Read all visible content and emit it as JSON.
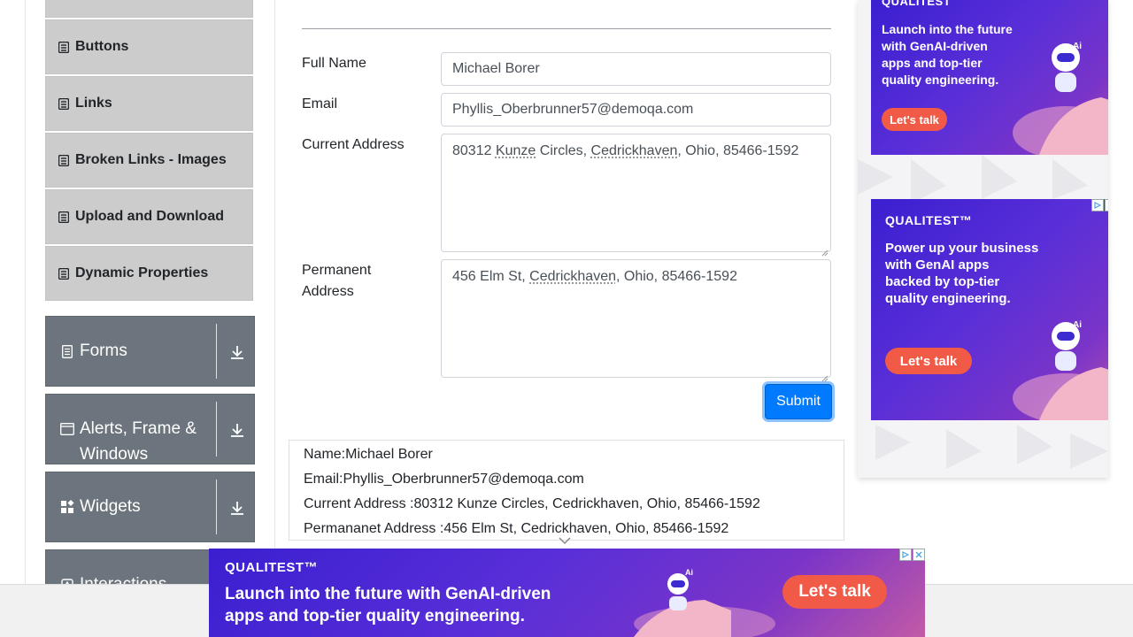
{
  "sidebar": {
    "elements_items": [
      {
        "label": "Buttons",
        "icon": "list-icon"
      },
      {
        "label": "Links",
        "icon": "list-icon"
      },
      {
        "label": "Broken Links - Images",
        "icon": "list-icon"
      },
      {
        "label": "Upload and Download",
        "icon": "list-icon"
      },
      {
        "label": "Dynamic Properties",
        "icon": "list-icon"
      }
    ],
    "groups": [
      {
        "label": "Forms",
        "icon": "document-icon"
      },
      {
        "label": "Alerts, Frame & Windows",
        "icon": "window-icon"
      },
      {
        "label": "Widgets",
        "icon": "widgets-icon"
      },
      {
        "label": "Interactions",
        "icon": "interactions-icon"
      }
    ]
  },
  "form": {
    "full_name_label": "Full Name",
    "full_name_value": "Michael Borer",
    "email_label": "Email",
    "email_value": "Phyllis_Oberbrunner57@demoqa.com",
    "current_address_label": "Current Address",
    "current_address_parts": [
      "80312 ",
      "Kunze",
      " Circles, ",
      "Cedrickhaven",
      ", Ohio, 85466-1592"
    ],
    "permanent_address_label": "Permanent Address",
    "permanent_address_parts": [
      "456 Elm St, ",
      "Cedrickhaven",
      ", Ohio, 85466-1592"
    ],
    "submit_label": "Submit"
  },
  "output": {
    "name": "Name:Michael Borer",
    "email": "Email:Phyllis_Oberbrunner57@demoqa.com",
    "current_address": "Current Address :80312 Kunze Circles, Cedrickhaven, Ohio, 85466-1592",
    "permanent_address": "Permananet Address :456 Elm St, Cedrickhaven, Ohio, 85466-1592"
  },
  "ads": {
    "top": {
      "brand": "QUALITEST",
      "copy_lines": [
        "Launch into the future",
        "with GenAI-driven",
        "apps and top-tier",
        "quality engineering."
      ],
      "cta": "Let's talk"
    },
    "middle": {
      "brand": "QUALITEST™",
      "copy_lines": [
        "Power up your business",
        "with GenAI apps",
        "backed by top-tier",
        "quality engineering."
      ],
      "cta": "Let's talk"
    },
    "bottom": {
      "brand": "QUALITEST™",
      "copy_lines": [
        "Launch into the future with GenAI-driven",
        "apps and top-tier quality engineering."
      ],
      "cta": "Let's talk"
    },
    "robot_label": "Ai"
  },
  "colors": {
    "submit": "#007bff",
    "group_bg": "#6c757d",
    "menu_item_bg": "#cccccc",
    "cta": "#f05a47"
  }
}
